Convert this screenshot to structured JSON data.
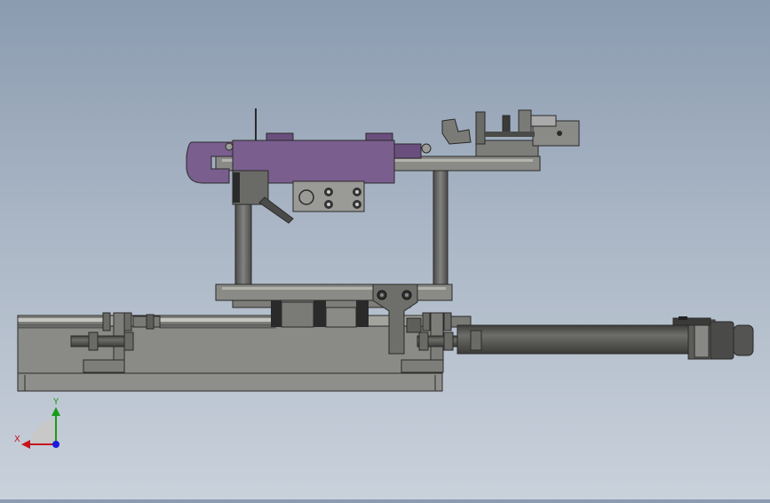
{
  "viewport": {
    "background_top": "#8b9bb0",
    "background_bottom": "#c9d1db"
  },
  "colors": {
    "steel": "#8a8a86",
    "steel_dark": "#5f5f5c",
    "steel_light": "#b8b8b2",
    "purple_part": "#7a5e8e",
    "purple_dark": "#5a4470",
    "outline": "#2a2a2a"
  },
  "triad": {
    "x_label": "X",
    "y_label": "Y",
    "x_color": "#c8141e",
    "y_color": "#1a9a1a",
    "z_color": "#1a1ae0"
  }
}
